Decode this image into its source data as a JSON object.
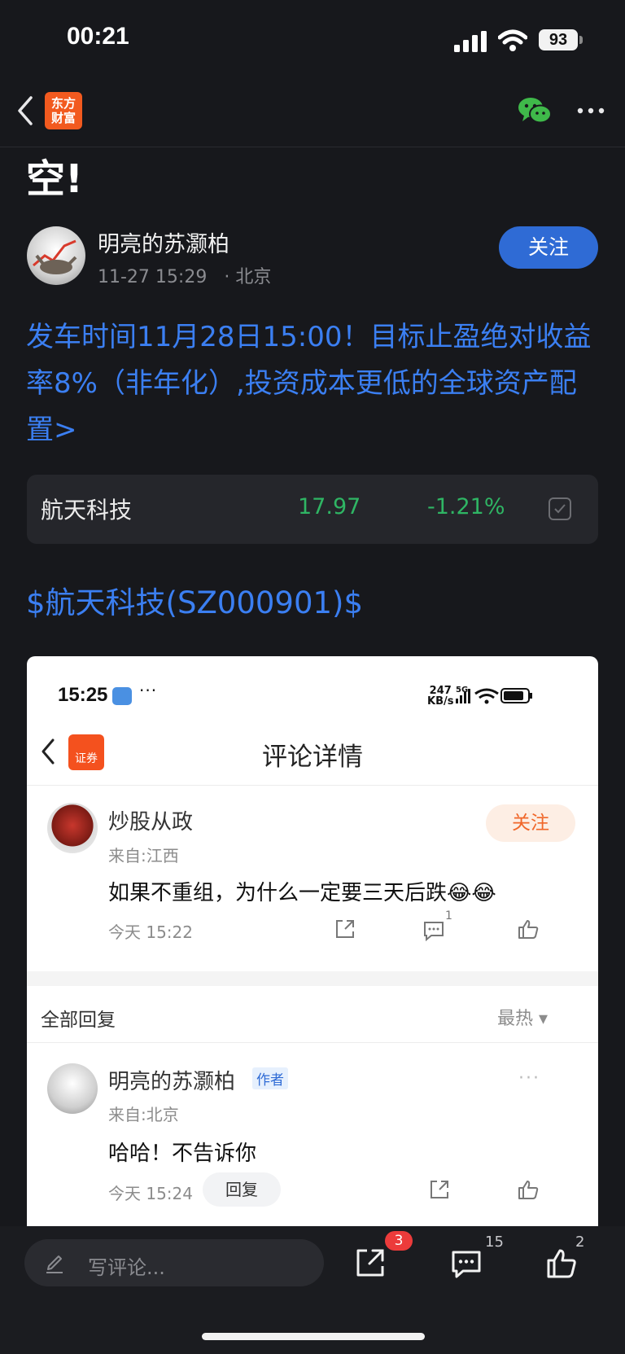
{
  "status_bar": {
    "time": "00:21",
    "battery": "93"
  },
  "navbar": {
    "logo_text": "东方\n财富"
  },
  "post": {
    "title_tail": "空!",
    "author": {
      "name": "明亮的苏灏柏",
      "datetime": "11-27 15:29",
      "location": "· 北京",
      "follow_label": "关注"
    },
    "promo_text": "发车时间11月28日15:00！目标止盈绝对收益率8%（非年化）,投资成本更低的全球资产配置>",
    "stock": {
      "name": "航天科技",
      "price": "17.97",
      "change": "-1.21%"
    },
    "stock_tag": "$航天科技(SZ000901)$"
  },
  "screenshot": {
    "status_time": "15:25",
    "network": "247\nKB/s",
    "logo_text": "证券",
    "title": "评论详情",
    "comment": {
      "user": "炒股从政",
      "from": "来自:江西",
      "text": "如果不重组，为什么一定要三天后跌😂😂",
      "time": "今天 15:22",
      "follow_label": "关注",
      "comment_count": "1"
    },
    "replies_header": {
      "label": "全部回复",
      "sort": "最热 ▾"
    },
    "reply": {
      "user": "明亮的苏灏柏",
      "badge": "作者",
      "from": "来自:北京",
      "text": "哈哈！不告诉你",
      "time": "今天 15:24",
      "reply_label": "回复"
    }
  },
  "bottom_bar": {
    "comment_placeholder": "写评论...",
    "share_badge": "3",
    "comment_count": "15",
    "like_count": "2"
  },
  "colors": {
    "accent_blue": "#3b7ff2",
    "stock_green": "#2fb564",
    "brand_orange": "#f25a1f",
    "badge_red": "#ec3b3b"
  },
  "icons": [
    "back-icon",
    "wechat-icon",
    "more-icon",
    "edit-icon",
    "share-icon",
    "comment-icon",
    "like-icon"
  ]
}
